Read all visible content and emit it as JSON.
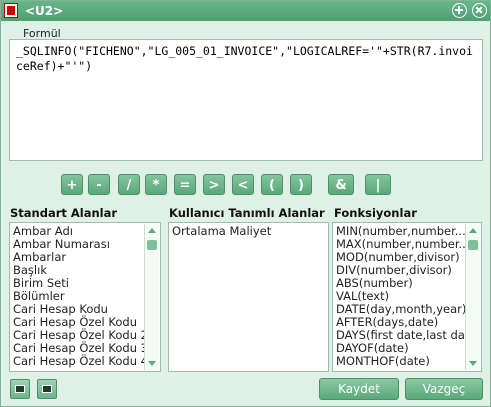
{
  "window": {
    "title": "<U2>"
  },
  "formula": {
    "label": "Formül",
    "text": "_SQLINFO(\"FICHENO\",\"LG_005_01_INVOICE\",\"LOGICALREF='\"+STR(R7.invoiceRef)+\"'\")"
  },
  "operators": [
    "+",
    "-",
    "/",
    "*",
    "=",
    ">",
    "<",
    "(",
    ")",
    "&",
    "|"
  ],
  "standard_fields": {
    "title": "Standart Alanlar",
    "items": [
      "Ambar Adı",
      "Ambar Numarası",
      "Ambarlar",
      "Başlık",
      "Birim Seti",
      "Bölümler",
      "Cari Hesap Kodu",
      "Cari Hesap Özel Kodu",
      "Cari Hesap Özel Kodu 2",
      "Cari Hesap Özel Kodu 3",
      "Cari Hesap Özel Kodu 4"
    ]
  },
  "user_fields": {
    "title": "Kullanıcı Tanımlı Alanlar",
    "items": [
      "Ortalama Maliyet"
    ]
  },
  "functions": {
    "title": "Fonksiyonlar",
    "items": [
      "MIN(number,number...",
      "MAX(number,number...",
      "MOD(number,divisor)",
      "DIV(number,divisor)",
      "ABS(number)",
      "VAL(text)",
      "DATE(day,month,year)",
      "AFTER(days,date)",
      "DAYS(first date,last da",
      "DAYOF(date)",
      "MONTHOF(date)"
    ]
  },
  "buttons": {
    "save": "Kaydet",
    "cancel": "Vazgeç"
  },
  "icons": {
    "app": "logo-icon",
    "restore": "plus-circle-icon",
    "close": "close-icon",
    "open": "folder-open-icon",
    "save_file": "save-icon"
  }
}
